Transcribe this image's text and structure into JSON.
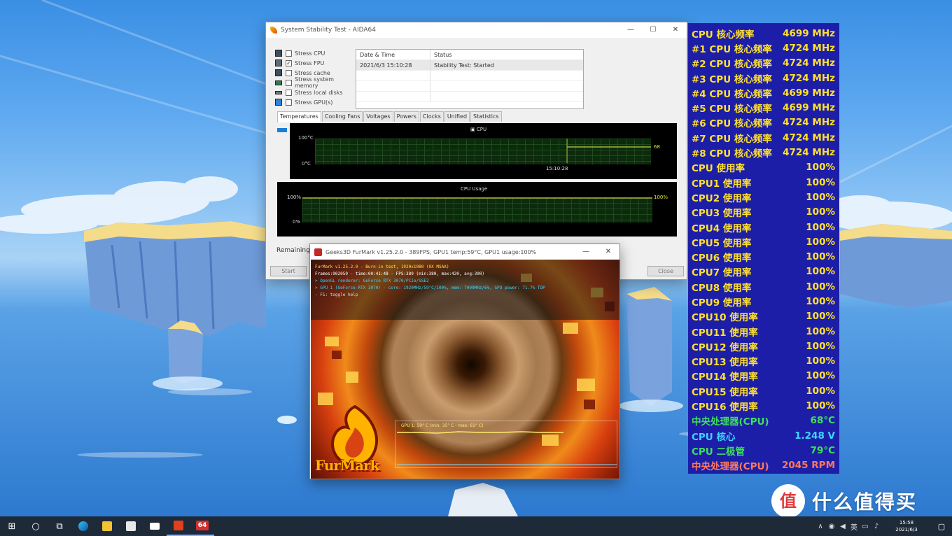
{
  "stress_window": {
    "title": "System Stability Test - AIDA64",
    "options": [
      {
        "label": "Stress CPU",
        "checked": false
      },
      {
        "label": "Stress FPU",
        "checked": true
      },
      {
        "label": "Stress cache",
        "checked": false
      },
      {
        "label": "Stress system memory",
        "checked": false
      },
      {
        "label": "Stress local disks",
        "checked": false
      },
      {
        "label": "Stress GPU(s)",
        "checked": false
      }
    ],
    "table": {
      "col1": "Date & Time",
      "col2": "Status",
      "rows": [
        {
          "datetime": "2021/6/3 15:10:28",
          "status": "Stability Test: Started"
        }
      ]
    },
    "tabs": [
      "Temperatures",
      "Cooling Fans",
      "Voltages",
      "Powers",
      "Clocks",
      "Unified",
      "Statistics"
    ],
    "active_tab": 0,
    "temp_graph": {
      "label": "CPU",
      "y_max": "100°C",
      "y_min": "0°C",
      "time_label": "15:10:28",
      "current": "68"
    },
    "usage_graph": {
      "label": "CPU Usage",
      "y_max": "100%",
      "y_min": "0%",
      "current": "100%"
    },
    "remaining_label": "Remaining B",
    "buttons": {
      "start": "Start",
      "close": "Close"
    }
  },
  "furmark_window": {
    "title": "Geeks3D FurMark v1.25.2.0 - 389FPS, GPU1 temp:59°C, GPU1 usage:100%",
    "info_lines": [
      "FurMark v1.25.2.0 - Burn-in test, 1920x1080 (0X MSAA)",
      "Frames:902059 - time:00:41:48 - FPS:389 (min:380, max:420, avg:390)",
      "> OpenGL renderer: GeForce RTX 3070/PCIe/SSE2",
      "> GPU 1 (GeForce RTX 3070) - core: 1920MHz/59°C/100%, mem: 7000MHz/6%, GPU power: 71.7% TDP",
      "- F1: toggle help"
    ],
    "gpu_temp_text": "GPU 1: 59° C (min: 35° C - max: 61° C)",
    "logo_text": "FurMark"
  },
  "osd": {
    "rows": [
      {
        "label": "CPU 核心频率",
        "value": "4699 MHz",
        "color": "#ffe12e"
      },
      {
        "label": "#1 CPU 核心频率",
        "value": "4724 MHz",
        "color": "#ffe12e"
      },
      {
        "label": "#2 CPU 核心频率",
        "value": "4724 MHz",
        "color": "#ffe12e"
      },
      {
        "label": "#3 CPU 核心频率",
        "value": "4724 MHz",
        "color": "#ffe12e"
      },
      {
        "label": "#4 CPU 核心频率",
        "value": "4699 MHz",
        "color": "#ffe12e"
      },
      {
        "label": "#5 CPU 核心频率",
        "value": "4699 MHz",
        "color": "#ffe12e"
      },
      {
        "label": "#6 CPU 核心频率",
        "value": "4724 MHz",
        "color": "#ffe12e"
      },
      {
        "label": "#7 CPU 核心频率",
        "value": "4724 MHz",
        "color": "#ffe12e"
      },
      {
        "label": "#8 CPU 核心频率",
        "value": "4724 MHz",
        "color": "#ffe12e"
      },
      {
        "label": "CPU 使用率",
        "value": "100%",
        "color": "#ffe12e"
      },
      {
        "label": "CPU1 使用率",
        "value": "100%",
        "color": "#ffe12e"
      },
      {
        "label": "CPU2 使用率",
        "value": "100%",
        "color": "#ffe12e"
      },
      {
        "label": "CPU3 使用率",
        "value": "100%",
        "color": "#ffe12e"
      },
      {
        "label": "CPU4 使用率",
        "value": "100%",
        "color": "#ffe12e"
      },
      {
        "label": "CPU5 使用率",
        "value": "100%",
        "color": "#ffe12e"
      },
      {
        "label": "CPU6 使用率",
        "value": "100%",
        "color": "#ffe12e"
      },
      {
        "label": "CPU7 使用率",
        "value": "100%",
        "color": "#ffe12e"
      },
      {
        "label": "CPU8 使用率",
        "value": "100%",
        "color": "#ffe12e"
      },
      {
        "label": "CPU9 使用率",
        "value": "100%",
        "color": "#ffe12e"
      },
      {
        "label": "CPU10 使用率",
        "value": "100%",
        "color": "#ffe12e"
      },
      {
        "label": "CPU11 使用率",
        "value": "100%",
        "color": "#ffe12e"
      },
      {
        "label": "CPU12 使用率",
        "value": "100%",
        "color": "#ffe12e"
      },
      {
        "label": "CPU13 使用率",
        "value": "100%",
        "color": "#ffe12e"
      },
      {
        "label": "CPU14 使用率",
        "value": "100%",
        "color": "#ffe12e"
      },
      {
        "label": "CPU15 使用率",
        "value": "100%",
        "color": "#ffe12e"
      },
      {
        "label": "CPU16 使用率",
        "value": "100%",
        "color": "#ffe12e"
      },
      {
        "label": "中央处理器(CPU)",
        "value": "68°C",
        "color": "#3ee05a"
      },
      {
        "label": "CPU 核心",
        "value": "1.248 V",
        "color": "#3fd4ff"
      },
      {
        "label": "CPU 二极管",
        "value": "79°C",
        "color": "#3ee05a"
      },
      {
        "label": "中央处理器(CPU)",
        "value": "2045 RPM",
        "color": "#ff7a5c"
      }
    ]
  },
  "watermark": {
    "logo_char": "值",
    "text": "什么值得买"
  },
  "taskbar": {
    "start_icon": "⊞",
    "search_icon": "○",
    "taskview_icon": "⧉",
    "aida_label": "64",
    "clock_time": "15:58",
    "clock_date": "2021/6/3",
    "notification_icon": "▢"
  },
  "colors": {
    "osd_bg": "#1d1ea8",
    "taskbar_bg": "#1f2a38",
    "graph_line": "#a8b43a"
  }
}
